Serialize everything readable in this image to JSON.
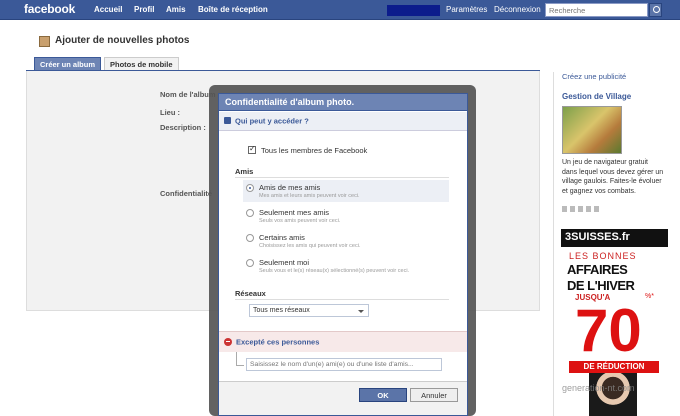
{
  "topbar": {
    "logo": "facebook",
    "nav": [
      "Accueil",
      "Profil",
      "Amis",
      "Boîte de réception"
    ],
    "right_links": [
      "Paramètres",
      "Déconnexion"
    ],
    "search_placeholder": "Recherche"
  },
  "page": {
    "title": "Ajouter de nouvelles photos",
    "tabs": [
      "Créer un album",
      "Photos de mobile"
    ],
    "form_labels": {
      "name": "Nom de l'album",
      "location": "Lieu :",
      "description": "Description :",
      "privacy": "Confidentialité"
    }
  },
  "sidebar": {
    "create_ad": "Créez une publicité",
    "ad_title": "Gestion de Village",
    "ad_text": "Un jeu de navigateur gratuit dans lequel vous devez gérer un village gaulois. Faites-le évoluer et gagnez vos combats.",
    "ad2": {
      "brand": "3SUISSES.fr",
      "line1": "LES BONNES",
      "line2": "AFFAIRES",
      "line3": "DE L'HIVER",
      "line4": "JUSQU'A",
      "number": "70",
      "pct": "%*",
      "reduction": "DE RÉDUCTION"
    },
    "watermark": "generation-nt.com"
  },
  "dialog": {
    "title": "Confidentialité d'album photo.",
    "subheader": "Qui peut y accéder ?",
    "everyone_checkbox": "Tous les membres de Facebook",
    "friends_heading": "Amis",
    "options": [
      {
        "title": "Amis de mes amis",
        "desc": "Mes amis et leurs amis peuvent voir ceci.",
        "selected": true
      },
      {
        "title": "Seulement mes amis",
        "desc": "Seuls vos amis peuvent voir ceci.",
        "selected": false
      },
      {
        "title": "Certains amis",
        "desc": "Choisissez les amis qui peuvent voir ceci.",
        "selected": false
      },
      {
        "title": "Seulement moi",
        "desc": "Seuls vous et le(s) réseau(x) sélectionné(s) peuvent voir ceci.",
        "selected": false
      }
    ],
    "networks_heading": "Réseaux",
    "networks_select": "Tous mes réseaux",
    "except_heading": "Excepté ces personnes",
    "except_placeholder": "Saisissez le nom d'un(e) ami(e) ou d'une liste d'amis...",
    "ok": "OK",
    "cancel": "Annuler"
  }
}
